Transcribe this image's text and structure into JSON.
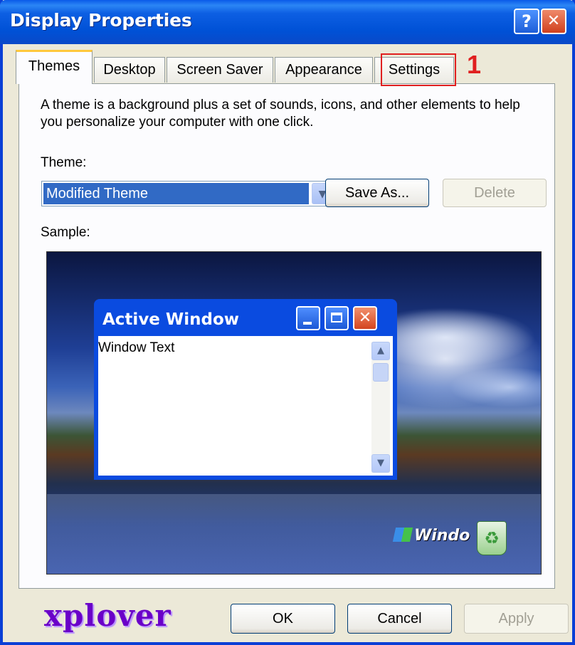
{
  "window": {
    "title": "Display Properties"
  },
  "titlebar": {
    "help_icon": "?",
    "close_icon": "✕"
  },
  "tabs": [
    {
      "label": "Themes",
      "active": true
    },
    {
      "label": "Desktop",
      "active": false
    },
    {
      "label": "Screen Saver",
      "active": false
    },
    {
      "label": "Appearance",
      "active": false
    },
    {
      "label": "Settings",
      "active": false
    }
  ],
  "annotation": {
    "marker": "1",
    "color": "#e02020"
  },
  "themes_panel": {
    "description": "A theme is a background plus a set of sounds, icons, and other elements to help you personalize your computer with one click.",
    "theme_label": "Theme:",
    "theme_value": "Modified Theme",
    "save_as_label": "Save As...",
    "delete_label": "Delete",
    "sample_label": "Sample:"
  },
  "sample_preview": {
    "active_window_title": "Active Window",
    "window_text": "Window Text",
    "logo_text": "Windo"
  },
  "footer": {
    "brand": "xplover",
    "ok_label": "OK",
    "cancel_label": "Cancel",
    "apply_label": "Apply"
  },
  "colors": {
    "titlebar": "#0a5ae8",
    "selection": "#316ac5",
    "brand": "#6a00c8"
  }
}
